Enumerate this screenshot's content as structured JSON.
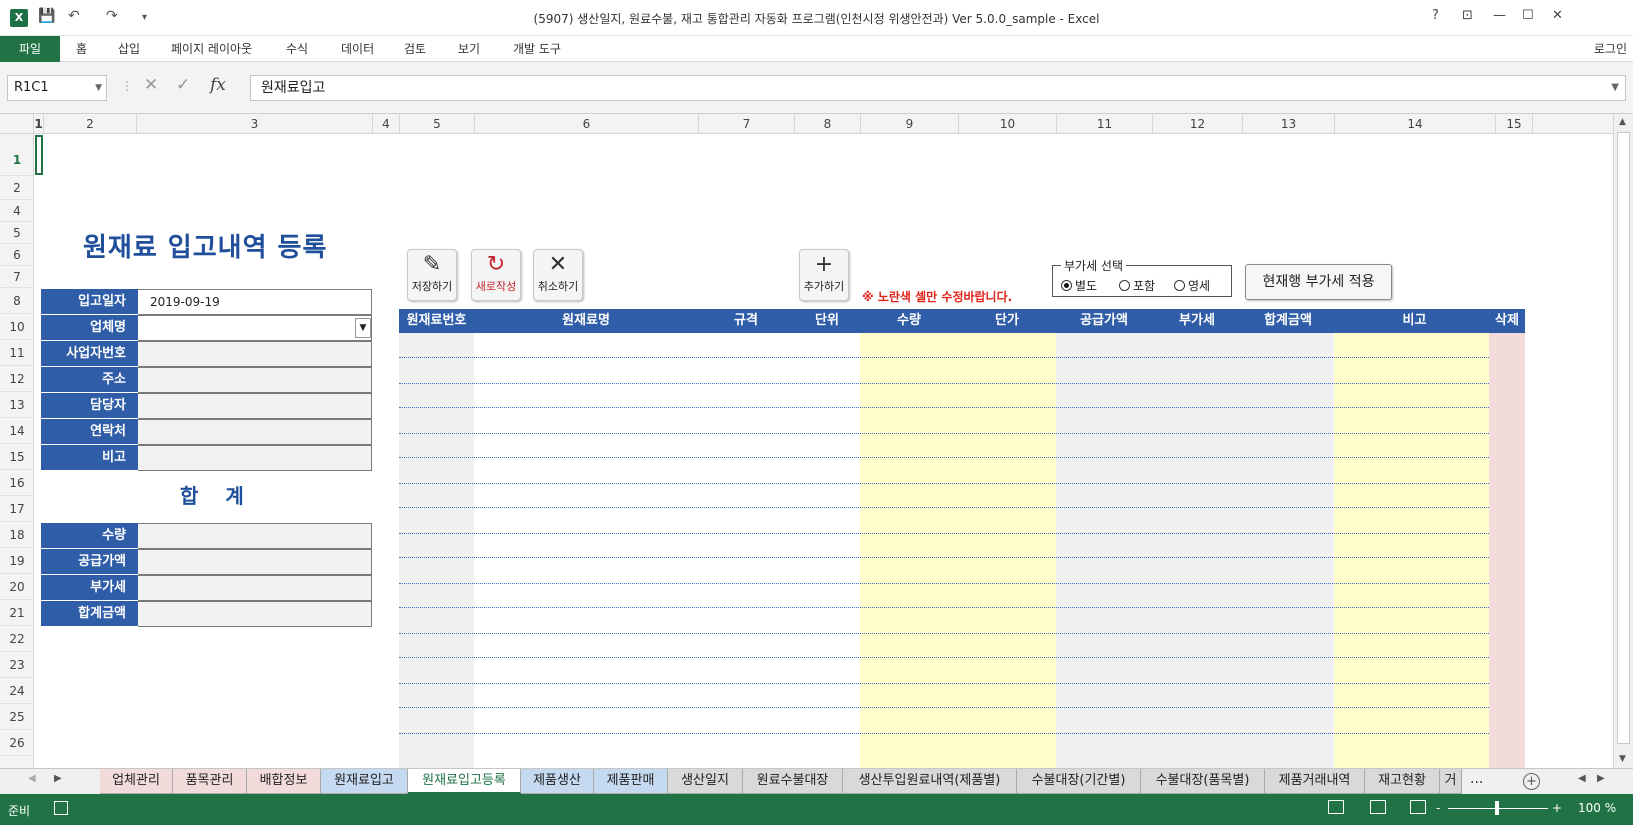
{
  "window": {
    "title": "(5907) 생산일지, 원료수불, 재고 통합관리 자동화 프로그램(인천시정 위생안전과) Ver 5.0.0_sample - Excel",
    "app_icon": "X",
    "help": "?",
    "minimize": "—",
    "restore": "☐",
    "close": "✕"
  },
  "quick_access": {
    "save_icon": "save-icon",
    "undo": "↶",
    "redo": "↷",
    "more": "▾"
  },
  "ribbon": {
    "tabs": [
      "파일",
      "홈",
      "삽입",
      "페이지 레이아웃",
      "수식",
      "데이터",
      "검토",
      "보기",
      "개발 도구"
    ],
    "login": "로그인"
  },
  "formula_bar": {
    "name_box": "R1C1",
    "formula": "원재료입고",
    "cancel": "✕",
    "enter": "✓",
    "fx": "fx"
  },
  "columns": [
    "1",
    "2",
    "3",
    "4",
    "5",
    "6",
    "7",
    "8",
    "9",
    "10",
    "11",
    "12",
    "13",
    "14",
    "15"
  ],
  "rows": [
    "1",
    "2",
    "4",
    "5",
    "6",
    "7",
    "8",
    "10",
    "11",
    "12",
    "13",
    "14",
    "15",
    "16",
    "17",
    "18",
    "19",
    "20",
    "21",
    "22",
    "23",
    "24",
    "25",
    "26"
  ],
  "form": {
    "heading": "원재료 입고내역 등록",
    "fields": [
      {
        "label": "입고일자",
        "value": "2019-09-19"
      },
      {
        "label": "업체명",
        "value": ""
      },
      {
        "label": "사업자번호",
        "value": ""
      },
      {
        "label": "주소",
        "value": ""
      },
      {
        "label": "담당자",
        "value": ""
      },
      {
        "label": "연락처",
        "value": ""
      },
      {
        "label": "비고",
        "value": ""
      }
    ],
    "sum_title": "합 계",
    "sums": [
      {
        "label": "수량",
        "value": ""
      },
      {
        "label": "공급가액",
        "value": ""
      },
      {
        "label": "부가세",
        "value": ""
      },
      {
        "label": "합계금액",
        "value": ""
      }
    ]
  },
  "buttons": {
    "save": "저장하기",
    "new": "새로작성",
    "cancel": "취소하기",
    "add": "추가하기",
    "apply_vat": "현재행 부가세 적용"
  },
  "notice": "※ 노란색 셀만 수정바랍니다.",
  "vat": {
    "legend": "부가세 선택",
    "options": [
      "별도",
      "포함",
      "영세"
    ],
    "selected": "별도"
  },
  "table": {
    "headers": [
      "원재료번호",
      "원재료명",
      "규격",
      "단위",
      "수량",
      "단가",
      "공급가액",
      "부가세",
      "합계금액",
      "비고",
      "삭제"
    ],
    "colors": {
      "gray": "#f0f0f0",
      "yellow": "#ffffcc",
      "pink": "#f2dcdb",
      "header": "#2f5da8"
    }
  },
  "sheet_tabs": [
    {
      "label": "업체관리",
      "color": "#f2dcdb"
    },
    {
      "label": "품목관리",
      "color": "#f2dcdb"
    },
    {
      "label": "배합정보",
      "color": "#f2dcdb"
    },
    {
      "label": "원재료입고",
      "color": "#c5d9f1"
    },
    {
      "label": "원재료입고등록",
      "color": "#ffffff"
    },
    {
      "label": "제품생산",
      "color": "#c5d9f1"
    },
    {
      "label": "제품판매",
      "color": "#c5d9f1"
    },
    {
      "label": "생산일지",
      "color": "#d9d9d9"
    },
    {
      "label": "원료수불대장",
      "color": "#d9d9d9"
    },
    {
      "label": "생산투입원료내역(제품별)",
      "color": "#d9d9d9"
    },
    {
      "label": "수불대장(기간별)",
      "color": "#d9d9d9"
    },
    {
      "label": "수불대장(품목별)",
      "color": "#d9d9d9"
    },
    {
      "label": "제품거래내역",
      "color": "#d9d9d9"
    },
    {
      "label": "재고현황",
      "color": "#d9d9d9"
    },
    {
      "label": "거",
      "color": "#d9d9d9"
    }
  ],
  "tab_more": "...",
  "status": {
    "ready": "준비",
    "zoom": "100 %",
    "minus": "-",
    "plus": "+"
  }
}
